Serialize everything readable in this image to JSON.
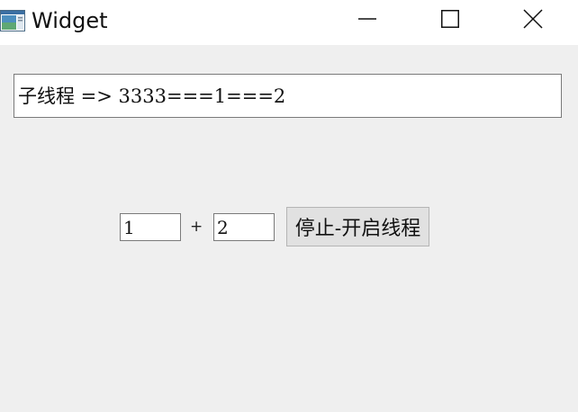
{
  "window": {
    "title": "Widget",
    "icon": "app-window-icon",
    "controls": [
      "minimize-icon",
      "maximize-icon",
      "close-icon"
    ]
  },
  "output": {
    "text": "子线程 => 3333===1===2"
  },
  "inputs": {
    "first": "1",
    "operator": "+",
    "second": "2"
  },
  "toggle_button": {
    "label": "停止-开启线程"
  }
}
